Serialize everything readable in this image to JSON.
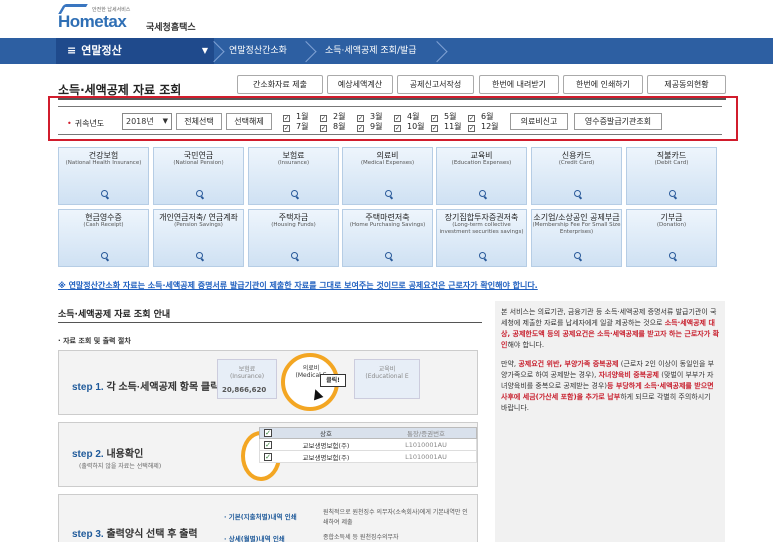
{
  "header": {
    "logo_small": "안전한 납세서비스",
    "logo_brand": "Hometax",
    "logo_kr": "국세청홈택스"
  },
  "topnav": {
    "menu_label": "연말정산",
    "crumbs": [
      "연말정산간소화",
      "소득·세액공제 조회/발급"
    ]
  },
  "page": {
    "title": "소득·세액공제 자료 조회",
    "tabs": [
      "간소화자료 제출",
      "예상세액계산",
      "공제신고서작성",
      "한번에 내려받기",
      "한번에 인쇄하기",
      "제공동의현황"
    ]
  },
  "filter": {
    "year_label": "귀속년도",
    "year_value": "2018년",
    "select_all": "전체선택",
    "deselect_all": "선택해제",
    "months": [
      "1월",
      "2월",
      "3월",
      "4월",
      "5월",
      "6월",
      "7월",
      "8월",
      "9월",
      "10월",
      "11월",
      "12월"
    ],
    "medical_report": "의료비신고",
    "receipt_agency": "영수증발급기관조회"
  },
  "categories": [
    {
      "kr": "건강보험",
      "en": "(National Health Insurance)"
    },
    {
      "kr": "국민연금",
      "en": "(National Pension)"
    },
    {
      "kr": "보험료",
      "en": "(Insurance)"
    },
    {
      "kr": "의료비",
      "en": "(Medical Expenses)"
    },
    {
      "kr": "교육비",
      "en": "(Education Expenses)"
    },
    {
      "kr": "신용카드",
      "en": "(Credit Card)"
    },
    {
      "kr": "직불카드",
      "en": "(Debit Card)"
    },
    {
      "kr": "현금영수증",
      "en": "(Cash Receipt)"
    },
    {
      "kr": "개인연금저축/ 연금계좌",
      "en": "(Pension Savings)"
    },
    {
      "kr": "주택자금",
      "en": "(Housing Funds)"
    },
    {
      "kr": "주택마련저축",
      "en": "(Home Purchasing Savings)"
    },
    {
      "kr": "장기집합투자증권저축",
      "en": "(Long-term collective investment securities savings)"
    },
    {
      "kr": "소기업/소상공인 공제부금",
      "en": "(Membership Fee For Small Size Enterprises)"
    },
    {
      "kr": "기부금",
      "en": "(Donation)"
    }
  ],
  "notice": "※ 연말정산간소화 자료는 소득·세액공제 증명서류 발급기관이 제출한 자료를 그대로 보여주는 것이므로 공제요건은 근로자가 확인해야 합니다.",
  "guide": {
    "title": "소득·세액공제 자료 조회 안내",
    "process_title": "· 자료 조회 및 출력 절차",
    "step1": {
      "num": "step 1.",
      "text": "각 소득·세액공제 항목 클릭",
      "card1_label": "보험료",
      "card1_sub": "(Insurance)",
      "card1_value": "20,866,620",
      "card2_label": "의료비",
      "card2_sub": "(Medical E",
      "card3_label": "교육비",
      "card3_sub": "(Educational E",
      "click": "클릭!"
    },
    "step2": {
      "num": "step 2.",
      "text": "내용확인",
      "sub": "(출력하지 않을 자료는 선택해제)",
      "col_company": "상호",
      "col_id": "통장/증권번호",
      "rows": [
        {
          "company": "교보생명보험(주)",
          "id": "L1010001AU"
        },
        {
          "company": "교보생명보험(주)",
          "id": "L1010001AU"
        }
      ]
    },
    "step3": {
      "num": "step 3.",
      "text": "출력양식 선택 후 출력",
      "items": [
        "· 기본(지출처별)내역 인쇄",
        "· 상세(월별)내역 인쇄"
      ],
      "desc1": "원칙적으로 원천징수 의무자(소속회사)에게 기본내역만 인쇄하여 제출",
      "desc2": "종합소득세 등 원천징수의무자"
    }
  },
  "info": {
    "p1_a": "본 서비스는 의료기관, 금융기관 등 소득·세액공제 증명서류 발급기관이 국세청에 제출한 자료를 납세자에게 일괄 제공하는 것으로 ",
    "p1_r": "소득·세액공제 대상, 공제한도액 등의 공제요건은 소득·세액공제를 받고자 하는 근로자가 확인",
    "p1_c": "해야 합니다.",
    "p2_a": "만약, ",
    "p2_r1": "공제요건 위반, 부양가족 중복공제",
    "p2_b": " (근로자 2인 이상이 동일인을 부양가족으로 하여 공제받는 경우), ",
    "p2_r2": "자녀양육비 중복공제",
    "p2_c": " (맞벌이 부부가 자녀양육비를 중복으로 공제받는 경우)",
    "p2_r3": "등 부당하게 소득·세액공제를 받으면 사후에 세금(가산세 포함)을 추가로 납부",
    "p2_d": "하게 되므로 각별히 주의하시기 바랍니다."
  }
}
